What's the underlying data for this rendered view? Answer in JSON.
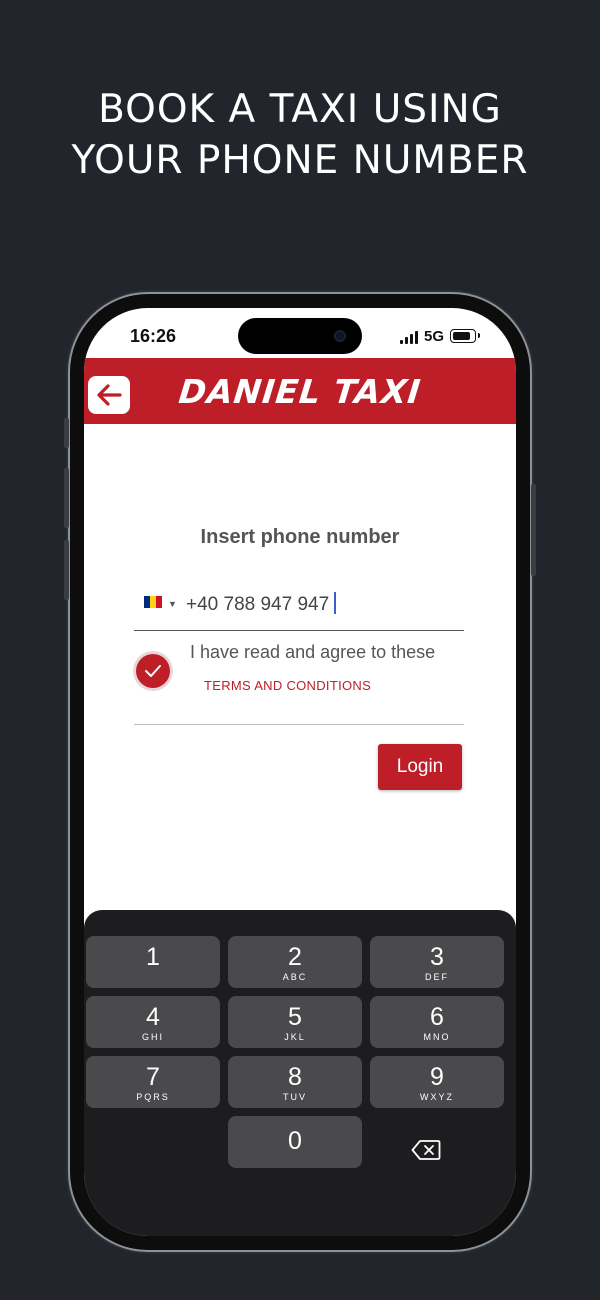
{
  "headline": [
    "BOOK A TAXI USING",
    "YOUR PHONE NUMBER"
  ],
  "status_bar": {
    "time": "16:26",
    "network": "5G"
  },
  "app_bar": {
    "brand": "DANIEL TAXI",
    "color": "#bd1e28"
  },
  "form": {
    "title": "Insert phone number",
    "country_flag": [
      "#002b7f",
      "#fcd116",
      "#ce1126"
    ],
    "phone_value": "+40 788 947 947",
    "agree_text": "I have read and agree to these",
    "terms_link": "TERMS AND CONDITIONS",
    "agree_checked": true,
    "login_label": "Login"
  },
  "keypad": {
    "keys": [
      {
        "num": "1",
        "letters": ""
      },
      {
        "num": "2",
        "letters": "ABC"
      },
      {
        "num": "3",
        "letters": "DEF"
      },
      {
        "num": "4",
        "letters": "GHI"
      },
      {
        "num": "5",
        "letters": "JKL"
      },
      {
        "num": "6",
        "letters": "MNO"
      },
      {
        "num": "7",
        "letters": "PQRS"
      },
      {
        "num": "8",
        "letters": "TUV"
      },
      {
        "num": "9",
        "letters": "WXYZ"
      },
      {
        "num": "0",
        "letters": ""
      }
    ],
    "delete_icon": "backspace-icon"
  }
}
